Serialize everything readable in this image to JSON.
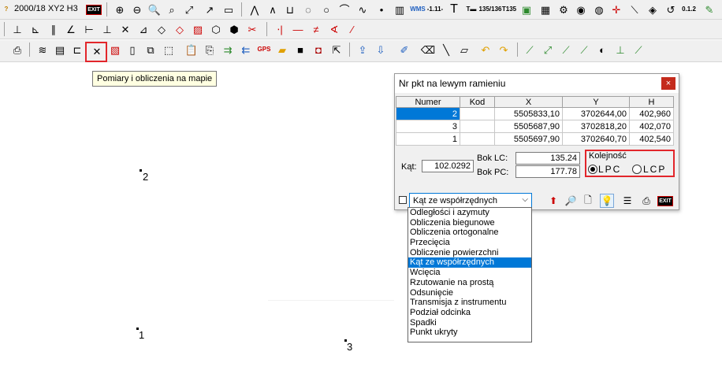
{
  "toolbar1": {
    "project": "2000/18 XY2 H3",
    "exit_label": "EXIT",
    "icons": [
      "zoom-in-icon",
      "zoom-out-icon",
      "zoom-window-icon",
      "zoom-prev-icon",
      "pan-icon",
      "refresh-icon",
      "window-icon"
    ],
    "text_tool_a": "-1.11-",
    "text_tool_b": "T",
    "text_tool_c": "135/136",
    "text_tool_d": "T135",
    "wms_label": "WMS",
    "scale_label": "0.1.2"
  },
  "toolbar3": {
    "selected_tool_tooltip": "Pomiary i obliczenia na mapie"
  },
  "map": {
    "points": [
      {
        "label": "2"
      },
      {
        "label": "1"
      },
      {
        "label": "3"
      }
    ]
  },
  "dialog": {
    "title": "Nr pkt na lewym ramieniu",
    "close": "×",
    "columns": [
      "Numer",
      "Kod",
      "X",
      "Y",
      "H"
    ],
    "rows": [
      {
        "numer": "2",
        "kod": "",
        "x": "5505833,10",
        "y": "3702644,00",
        "h": "402,960"
      },
      {
        "numer": "3",
        "kod": "",
        "x": "5505687,90",
        "y": "3702818,20",
        "h": "402,070"
      },
      {
        "numer": "1",
        "kod": "",
        "x": "5505697,90",
        "y": "3702640,70",
        "h": "402,540"
      }
    ],
    "kat_label": "Kąt:",
    "kat_value": "102.0292",
    "bok_lc_label": "Bok LC:",
    "bok_lc_value": "135.24",
    "bok_pc_label": "Bok PC:",
    "bok_pc_value": "177.78",
    "kolejnosc_label": "Kolejność",
    "option_lpc": "LPC",
    "option_lcp": "LCP",
    "combo_value": "Kąt ze współrzędnych",
    "exit_label": "EXIT"
  },
  "dropdown": {
    "options": [
      "Odległości i azymuty",
      "Obliczenia biegunowe",
      "Obliczenia ortogonalne",
      "Przecięcia",
      "Obliczenie powierzchni",
      "Kąt ze współrzędnych",
      "Wcięcia",
      "Rzutowanie na prostą",
      "Odsunięcie",
      "Transmisja z instrumentu",
      "Podział odcinka",
      "Spadki",
      "Punkt ukryty"
    ],
    "selected": "Kąt ze współrzędnych"
  },
  "colors": {
    "selection": "#0078d7",
    "highlight": "#e2262b",
    "tooltip_bg": "#ffffe1",
    "close_button": "#c42b1c"
  }
}
